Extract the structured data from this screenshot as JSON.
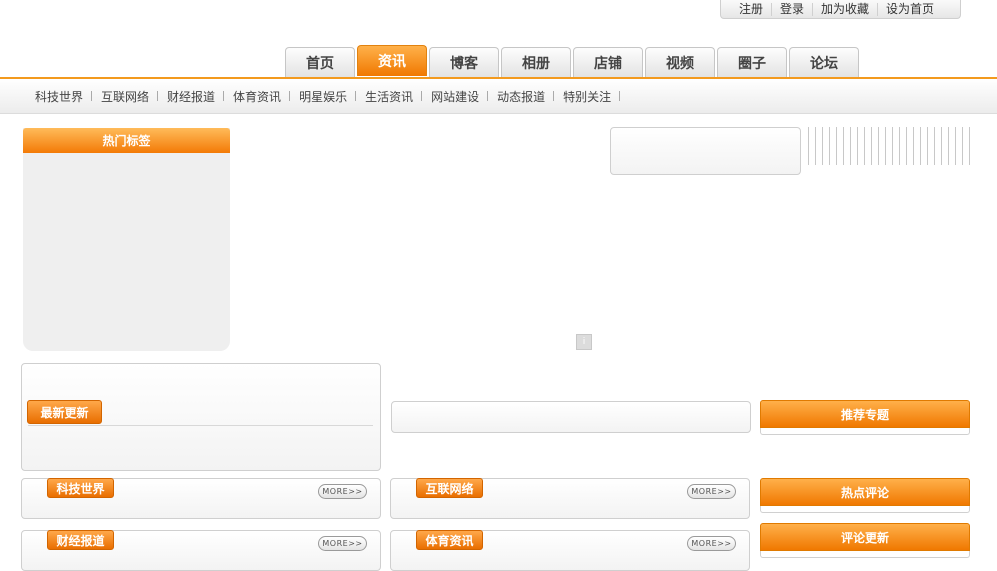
{
  "top_links": [
    "注册",
    "登录",
    "加为收藏",
    "设为首页"
  ],
  "nav_tabs": [
    "首页",
    "资讯",
    "博客",
    "相册",
    "店铺",
    "视频",
    "圈子",
    "论坛"
  ],
  "active_tab": "资讯",
  "sub_nav": [
    "科技世界",
    "互联网络",
    "财经报道",
    "体育资讯",
    "明星娱乐",
    "生活资讯",
    "网站建设",
    "动态报道",
    "特别关注"
  ],
  "hot_tags": {
    "title": "热门标签"
  },
  "latest": {
    "title": "最新更新"
  },
  "sections": {
    "tech": "科技世界",
    "internet": "互联网络",
    "finance": "财经报道",
    "sports": "体育资讯",
    "more_label": "MORE>>"
  },
  "right_panels": {
    "recommend": "推荐专题",
    "hot_comments": "热点评论",
    "comment_updates": "评论更新"
  },
  "slider_button": "i",
  "colors": {
    "accent": "#f37a06",
    "accent_light": "#ffb04a",
    "border": "#cfcfcf"
  }
}
